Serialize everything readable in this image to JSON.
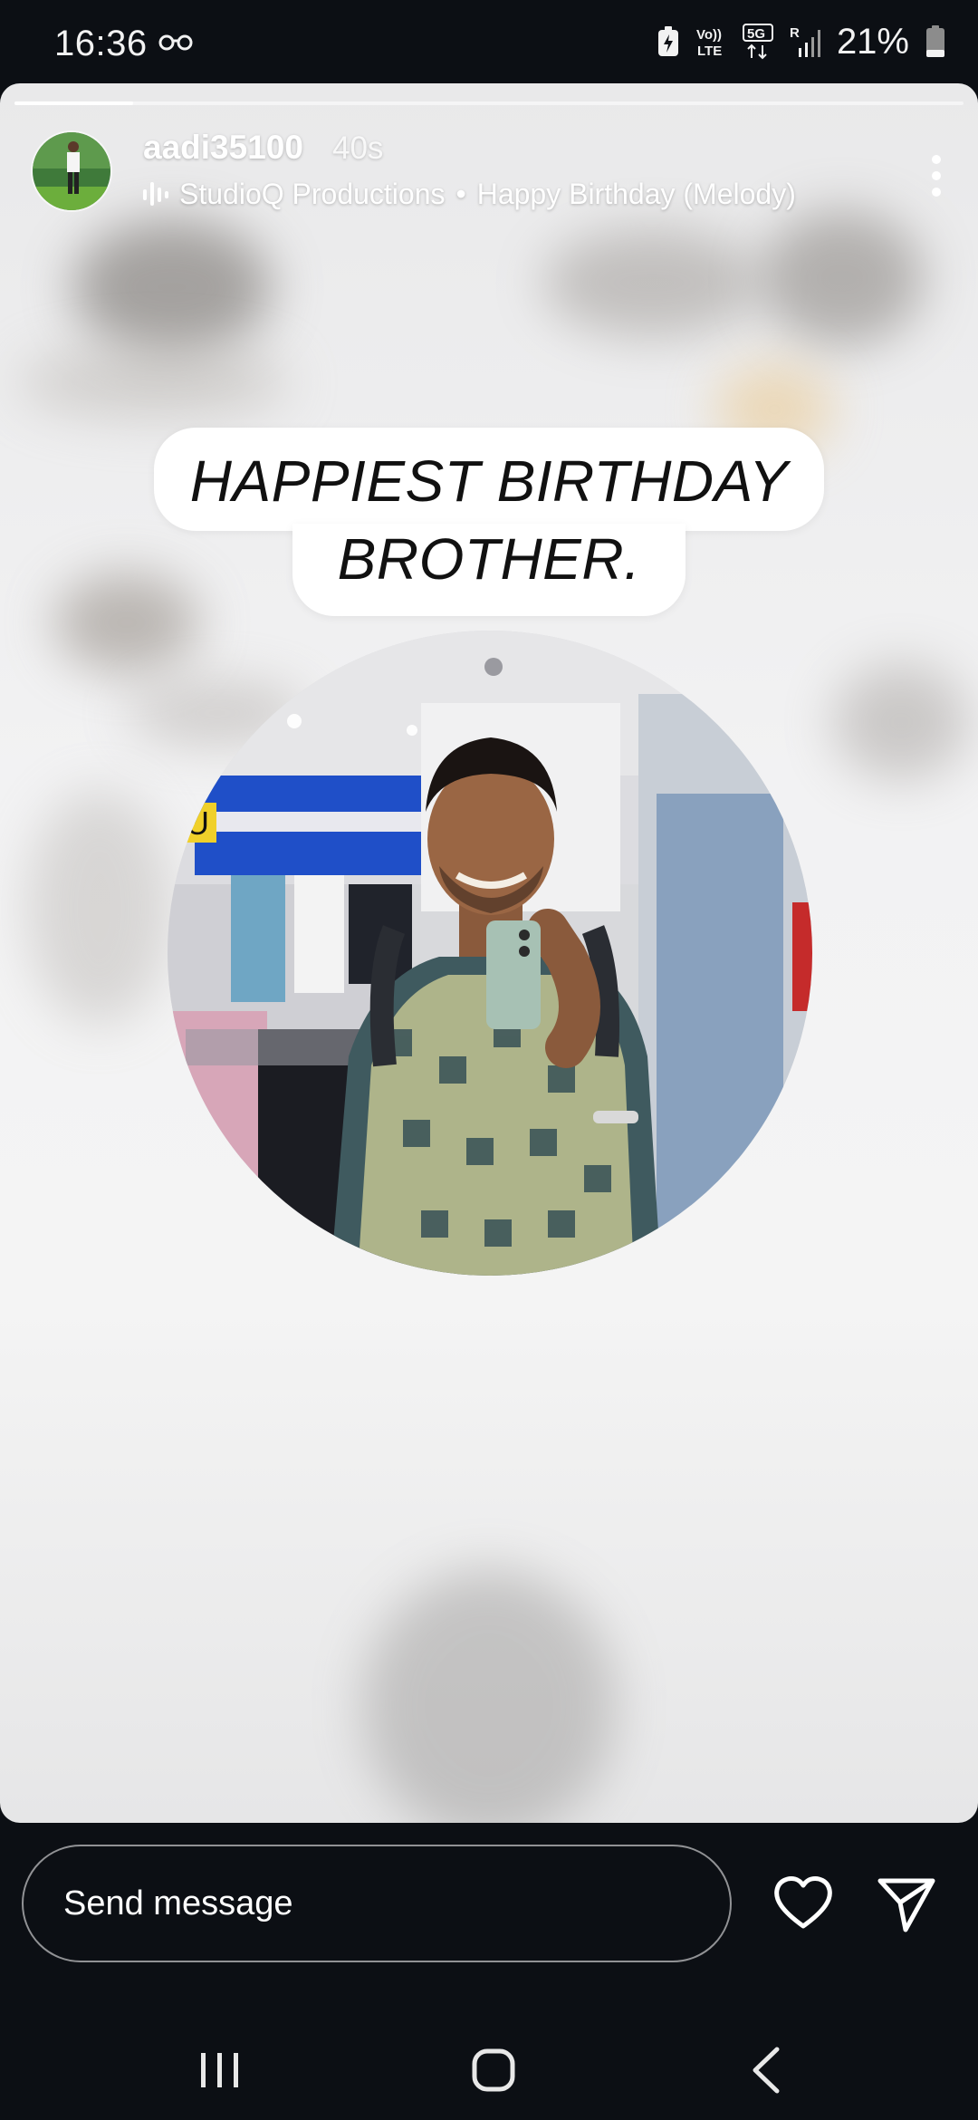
{
  "status_bar": {
    "time": "16:36",
    "network_labels": [
      "Vo)) LTE",
      "5G",
      "R"
    ],
    "battery_percent": "21%",
    "icons": [
      "dual-sim-icon",
      "battery-saver-icon",
      "volte-icon",
      "5g-icon",
      "signal-icon",
      "battery-icon"
    ]
  },
  "story": {
    "progress_fraction": 0.125,
    "username": "aadi35100",
    "time_ago": "40s",
    "music": {
      "artist": "StudioQ Productions",
      "separator": "•",
      "song": "Happy Birthday (Melody)"
    },
    "caption_line1": "HAPPIEST BIRTHDAY",
    "caption_line2": "BROTHER."
  },
  "reply_bar": {
    "placeholder": "Send message"
  },
  "nav_bar": {
    "icons": [
      "recents-icon",
      "home-icon",
      "back-icon"
    ]
  },
  "colors": {
    "background": "#0c0f14",
    "story_bg": "#f2f2f3",
    "text_light": "#ffffff"
  }
}
